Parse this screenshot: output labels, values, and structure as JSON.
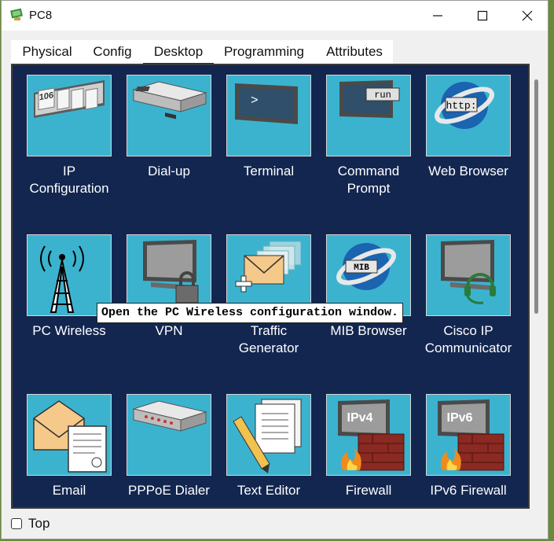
{
  "window": {
    "title": "PC8",
    "icon": "packet-tracer-icon"
  },
  "controls": {
    "minimize": "minimize-icon",
    "maximize": "maximize-icon",
    "close": "close-icon"
  },
  "tabs": [
    {
      "label": "Physical",
      "active": false
    },
    {
      "label": "Config",
      "active": false
    },
    {
      "label": "Desktop",
      "active": true
    },
    {
      "label": "Programming",
      "active": false
    },
    {
      "label": "Attributes",
      "active": false
    }
  ],
  "apps": [
    {
      "label": "IP\nConfiguration",
      "icon": "ip-configuration-icon",
      "icon_text": "106"
    },
    {
      "label": "Dial-up",
      "icon": "dial-up-icon"
    },
    {
      "label": "Terminal",
      "icon": "terminal-icon",
      "icon_text": ">"
    },
    {
      "label": "Command\nPrompt",
      "icon": "command-prompt-icon",
      "icon_text": "run"
    },
    {
      "label": "Web Browser",
      "icon": "web-browser-icon",
      "icon_text": "http:"
    },
    {
      "label": "PC Wireless",
      "icon": "pc-wireless-icon"
    },
    {
      "label": "VPN",
      "icon": "vpn-icon"
    },
    {
      "label": "Traffic\nGenerator",
      "icon": "traffic-generator-icon"
    },
    {
      "label": "MIB Browser",
      "icon": "mib-browser-icon",
      "icon_text": "MIB"
    },
    {
      "label": "Cisco IP\nCommunicator",
      "icon": "cisco-ip-communicator-icon"
    },
    {
      "label": "Email",
      "icon": "email-icon"
    },
    {
      "label": "PPPoE Dialer",
      "icon": "pppoe-dialer-icon"
    },
    {
      "label": "Text Editor",
      "icon": "text-editor-icon"
    },
    {
      "label": "Firewall",
      "icon": "firewall-icon",
      "icon_text": "IPv4"
    },
    {
      "label": "IPv6 Firewall",
      "icon": "ipv6-firewall-icon",
      "icon_text": "IPv6"
    }
  ],
  "tooltip": "Open the PC Wireless configuration window.",
  "footer": {
    "top_label": "Top",
    "top_checked": false
  },
  "colors": {
    "desktop_bg": "#122650",
    "tile_bg": "#3bb3cf",
    "accent": "#1c3355"
  }
}
